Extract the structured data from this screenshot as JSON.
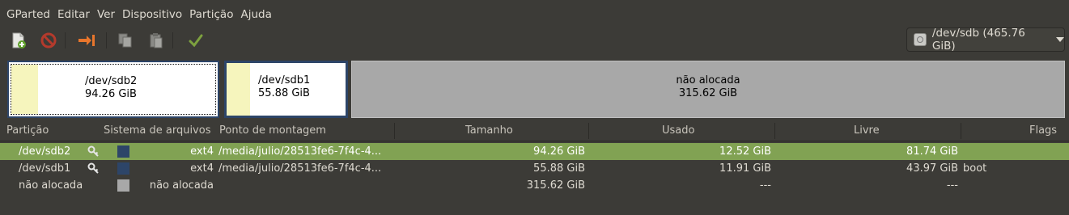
{
  "menubar": {
    "items": [
      "GParted",
      "Editar",
      "Ver",
      "Dispositivo",
      "Partição",
      "Ajuda"
    ]
  },
  "toolbar": {
    "buttons": [
      "new-partition-icon",
      "delete-icon",
      "resize-move-icon",
      "copy-icon",
      "paste-icon",
      "apply-icon"
    ],
    "device_label": "/dev/sdb (465.76 GiB)"
  },
  "partition_map": {
    "sdb2": {
      "name": "/dev/sdb2",
      "size": "94.26 GiB",
      "used_fraction": 0.13
    },
    "sdb1": {
      "name": "/dev/sdb1",
      "size": "55.88 GiB",
      "used_fraction": 0.21
    },
    "unallocated": {
      "name": "não alocada",
      "size": "315.62 GiB"
    }
  },
  "table": {
    "headers": {
      "partition": "Partição",
      "filesystem": "Sistema de arquivos",
      "mountpoint": "Ponto de montagem",
      "size": "Tamanho",
      "used": "Usado",
      "free": "Livre",
      "flags": "Flags"
    },
    "rows": [
      {
        "partition": "/dev/sdb2",
        "fs_color": "#2d4568",
        "filesystem": "ext4",
        "mountpoint": "/media/julio/28513fe6-7f4c-4...",
        "size": "94.26 GiB",
        "used": "12.52 GiB",
        "free": "81.74 GiB",
        "flags": ""
      },
      {
        "partition": "/dev/sdb1",
        "fs_color": "#2d4568",
        "filesystem": "ext4",
        "mountpoint": "/media/julio/28513fe6-7f4c-4...",
        "size": "55.88 GiB",
        "used": "11.91 GiB",
        "free": "43.97 GiB",
        "flags": "boot"
      },
      {
        "partition": "não alocada",
        "fs_color": "#a8a8a8",
        "filesystem": "não alocada",
        "mountpoint": "",
        "size": "315.62 GiB",
        "used": "---",
        "free": "---",
        "flags": ""
      }
    ]
  },
  "colors": {
    "window_bg": "#3c3b37",
    "selected_row": "#81a253",
    "ext4": "#2d4568",
    "used_space": "#f6f5bd",
    "unallocated": "#a8a8a8"
  }
}
